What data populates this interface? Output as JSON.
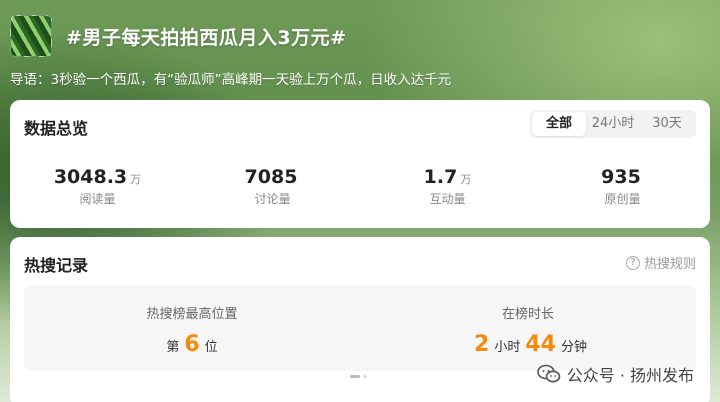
{
  "topic": {
    "title": "#男子每天拍拍西瓜月入3万元#"
  },
  "intro": "导语：3秒验一个西瓜，有“验瓜师”高峰期一天验上万个瓜，日收入达千元",
  "overview": {
    "title": "数据总览",
    "tabs": [
      {
        "label": "全部",
        "active": true
      },
      {
        "label": "24小时",
        "active": false
      },
      {
        "label": "30天",
        "active": false
      }
    ],
    "stats": [
      {
        "value": "3048.3",
        "unit": "万",
        "label": "阅读量"
      },
      {
        "value": "7085",
        "unit": "",
        "label": "讨论量"
      },
      {
        "value": "1.7",
        "unit": "万",
        "label": "互动量"
      },
      {
        "value": "935",
        "unit": "",
        "label": "原创量"
      }
    ]
  },
  "hot_record": {
    "title": "热搜记录",
    "rules_label": "热搜规则",
    "highest_position": {
      "label": "热搜榜最高位置",
      "prefix": "第",
      "value": "6",
      "suffix": "位"
    },
    "duration": {
      "label": "在榜时长",
      "hours": "2",
      "hours_unit": "小时",
      "minutes": "44",
      "minutes_unit": "分钟"
    }
  },
  "watermark": {
    "text": "公众号 · 扬州发布",
    "icon": "wechat-icon"
  }
}
